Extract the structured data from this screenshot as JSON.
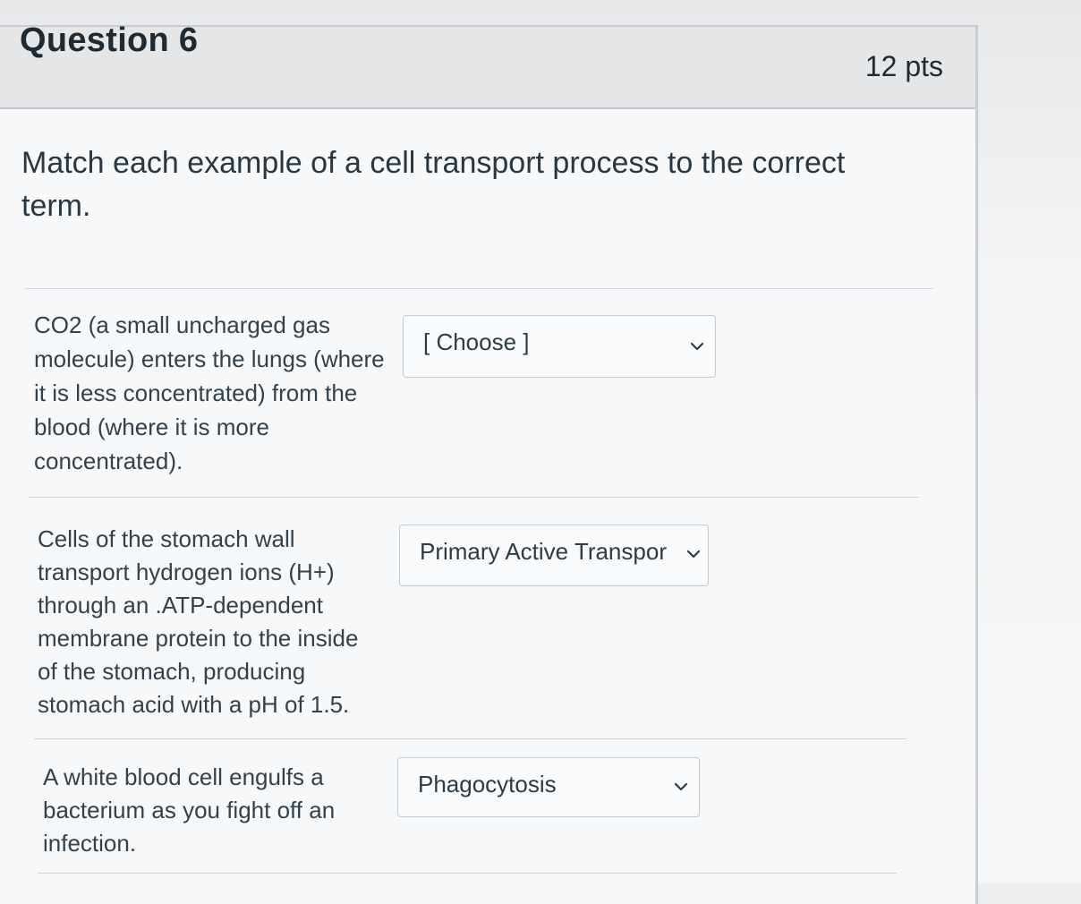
{
  "question": {
    "title": "Question 6",
    "points": "12 pts",
    "prompt": "Match each example of a cell transport process to the correct term."
  },
  "matches": [
    {
      "text": "CO2 (a small uncharged gas molecule) enters the lungs (where it is less concentrated) from the blood (where it is more concentrated).",
      "selected": "[ Choose ]"
    },
    {
      "text": "Cells of the stomach wall transport hydrogen ions (H+) through an .ATP-dependent membrane protein to the inside of the stomach, producing stomach acid with a pH of 1.5.",
      "selected": "Primary Active Transport"
    },
    {
      "text": "A white blood cell engulfs a bacterium as you fight off an infection.",
      "selected": "Phagocytosis"
    }
  ],
  "icons": {
    "dropdown": "chevron-down-icon"
  }
}
